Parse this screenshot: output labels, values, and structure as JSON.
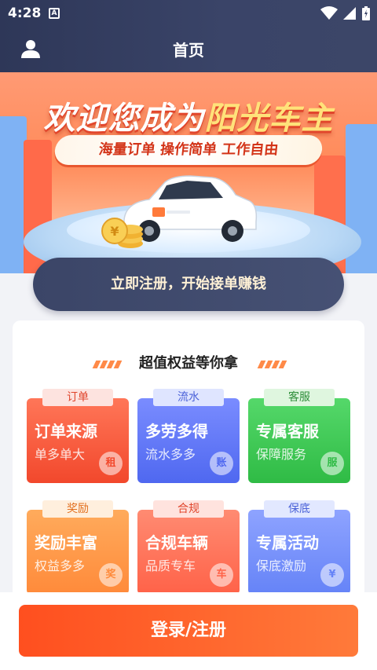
{
  "status_bar": {
    "time": "4:28",
    "notification_glyph": "A"
  },
  "header": {
    "title": "首页"
  },
  "banner": {
    "title_part1": "欢迎您成为",
    "title_part2": "阳光车主",
    "subtitle": "海量订单  操作简单  工作自由"
  },
  "cta": {
    "label": "立即注册，开始接单赚钱"
  },
  "benefits": {
    "heading": "超值权益等你拿",
    "tiles": [
      {
        "tag": "订单",
        "title": "订单来源",
        "desc": "单多单大",
        "badge": "租",
        "color": "#f2482c",
        "tag_bg": "#fde3df",
        "tag_fg": "#e0452c"
      },
      {
        "tag": "流水",
        "title": "多劳多得",
        "desc": "流水多多",
        "badge": "账",
        "color": "#4f68f0",
        "tag_bg": "#dfe5ff",
        "tag_fg": "#4b62d8"
      },
      {
        "tag": "客服",
        "title": "专属客服",
        "desc": "保障服务",
        "badge": "服",
        "color": "#2fbb45",
        "tag_bg": "#dff6df",
        "tag_fg": "#2f8f3a"
      },
      {
        "tag": "奖励",
        "title": "奖励丰富",
        "desc": "权益多多",
        "badge": "奖",
        "color": "#ff8a3a",
        "tag_bg": "#ffefdd",
        "tag_fg": "#e2701f"
      },
      {
        "tag": "合规",
        "title": "合规车辆",
        "desc": "品质专车",
        "badge": "车",
        "color": "#ff6248",
        "tag_bg": "#ffe3de",
        "tag_fg": "#e0452c"
      },
      {
        "tag": "保底",
        "title": "专属活动",
        "desc": "保底激励",
        "badge": "¥",
        "color": "#6583f7",
        "tag_bg": "#e2e8ff",
        "tag_fg": "#4b62d8"
      }
    ]
  },
  "bottom": {
    "login_label": "登录/注册"
  },
  "icons": {
    "user": "user-icon",
    "wifi": "wifi-icon",
    "signal": "signal-icon",
    "battery": "battery-icon"
  }
}
